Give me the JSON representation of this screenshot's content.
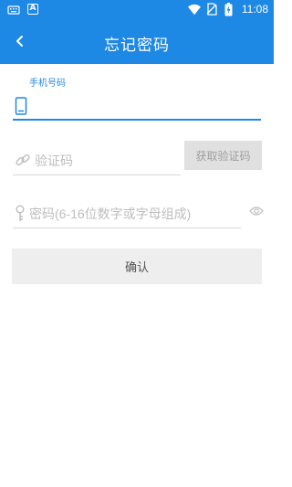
{
  "status_bar": {
    "time": "11:08",
    "icons": [
      "keyboard-icon",
      "app-a-icon",
      "wifi-icon",
      "no-sim-icon",
      "battery-charging-icon"
    ],
    "app_icon_letter": "A"
  },
  "app_bar": {
    "title": "忘记密码",
    "back_icon": "chevron-left-icon"
  },
  "form": {
    "phone": {
      "label": "手机号码",
      "value": "",
      "icon": "phone-icon"
    },
    "code": {
      "placeholder": "验证码",
      "value": "",
      "icon": "link-icon"
    },
    "get_code_label": "获取验证码",
    "password": {
      "placeholder": "密码(6-16位数字或字母组成)",
      "value": "",
      "icon": "key-icon",
      "toggle_icon": "eye-icon"
    },
    "confirm_label": "确认"
  },
  "colors": {
    "primary": "#1e88e5",
    "placeholder": "#bdbdbd",
    "divider": "#d8d8d8",
    "disabled_button": "#e0e0e0",
    "confirm_button": "#eeeeee"
  }
}
